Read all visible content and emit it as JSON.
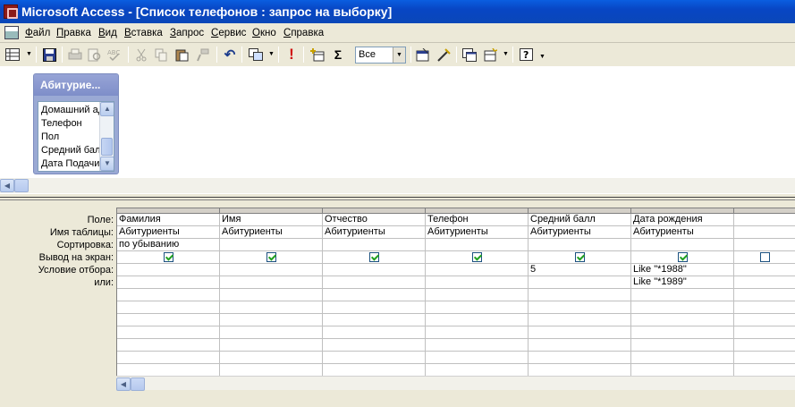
{
  "window": {
    "title": "Microsoft Access - [Список телефонов : запрос на выборку]"
  },
  "menu": [
    {
      "label": "Файл",
      "key": "Ф",
      "rest": "айл"
    },
    {
      "label": "Правка",
      "key": "П",
      "rest": "равка"
    },
    {
      "label": "Вид",
      "key": "В",
      "rest": "ид"
    },
    {
      "label": "Вставка",
      "key": "В",
      "rest": "ставка"
    },
    {
      "label": "Запрос",
      "key": "З",
      "rest": "апрос"
    },
    {
      "label": "Сервис",
      "key": "С",
      "rest": "ервис"
    },
    {
      "label": "Окно",
      "key": "О",
      "rest": "кно"
    },
    {
      "label": "Справка",
      "key": "С",
      "rest": "правка"
    }
  ],
  "toolbar": {
    "top_values": "Все",
    "sigma": "Σ",
    "run": "!",
    "undo": "↶"
  },
  "field_list": {
    "title": "Абитурие...",
    "items": [
      "Домашний адрес",
      "Телефон",
      "Пол",
      "Средний балл",
      "Дата Подачи"
    ]
  },
  "grid": {
    "row_labels": [
      "Поле:",
      "Имя таблицы:",
      "Сортировка:",
      "Вывод на экран:",
      "Условие отбора:",
      "или:"
    ],
    "columns": [
      {
        "field": "Фамилия",
        "table": "Абитуриенты",
        "sort": "по убыванию",
        "show": true,
        "criteria": "",
        "or": ""
      },
      {
        "field": "Имя",
        "table": "Абитуриенты",
        "sort": "",
        "show": true,
        "criteria": "",
        "or": ""
      },
      {
        "field": "Отчество",
        "table": "Абитуриенты",
        "sort": "",
        "show": true,
        "criteria": "",
        "or": ""
      },
      {
        "field": "Телефон",
        "table": "Абитуриенты",
        "sort": "",
        "show": true,
        "criteria": "",
        "or": ""
      },
      {
        "field": "Средний балл",
        "table": "Абитуриенты",
        "sort": "",
        "show": true,
        "criteria": "5",
        "or": ""
      },
      {
        "field": "Дата рождения",
        "table": "Абитуриенты",
        "sort": "",
        "show": true,
        "criteria": "Like \"*1988\"",
        "or": "Like \"*1989\""
      },
      {
        "field": "",
        "table": "",
        "sort": "",
        "show": false,
        "criteria": "",
        "or": ""
      }
    ]
  }
}
